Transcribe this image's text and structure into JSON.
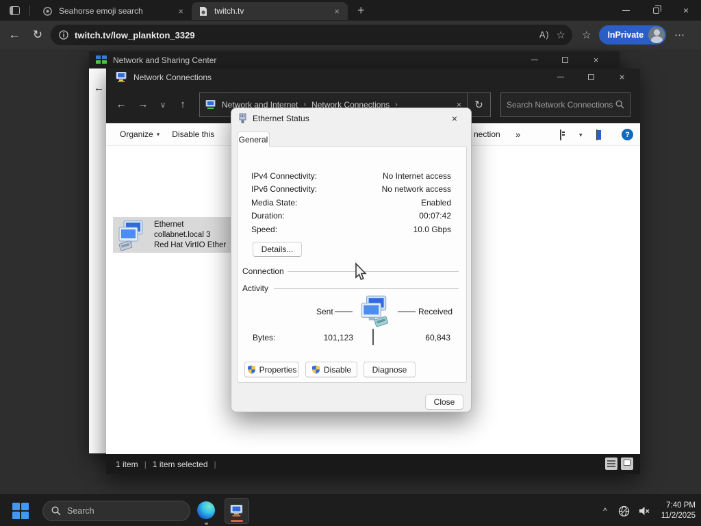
{
  "glyphs": {
    "close": "×",
    "back": "←",
    "forward": "→",
    "up": "↑",
    "down": "∨",
    "refresh": "↻",
    "plus": "+",
    "dots": "⋯",
    "star": "☆",
    "hub_star": "☆",
    "caret": "▾",
    "chevrons": "»",
    "crumb_sep": "›",
    "pipe": "|",
    "readaloud": "A)",
    "tray_chevron": "^",
    "help": "?"
  },
  "browser": {
    "tabs": [
      {
        "label": "Seahorse emoji search"
      },
      {
        "label": "twitch.tv"
      }
    ],
    "url": "twitch.tv/low_plankton_3329",
    "inprivate_label": "InPrivate"
  },
  "nsc_window": {
    "title": "Network and Sharing Center"
  },
  "nc_window": {
    "title": "Network Connections",
    "crumbs": [
      "Network and Internet",
      "Network Connections"
    ],
    "search_placeholder": "Search Network Connections",
    "toolbar": {
      "organize": "Organize",
      "disable_fragment": "Disable this",
      "connection_fragment": "nection"
    },
    "item": {
      "name": "Ethernet",
      "line2": "collabnet.local 3",
      "line3": "Red Hat VirtIO Ether"
    },
    "status": {
      "count": "1 item",
      "selected": "1 item selected"
    }
  },
  "dialog": {
    "title": "Ethernet Status",
    "tab_general": "General",
    "connection_label": "Connection",
    "rows": [
      {
        "label": "IPv4 Connectivity:",
        "value": "No Internet access"
      },
      {
        "label": "IPv6 Connectivity:",
        "value": "No network access"
      },
      {
        "label": "Media State:",
        "value": "Enabled"
      },
      {
        "label": "Duration:",
        "value": "00:07:42"
      },
      {
        "label": "Speed:",
        "value": "10.0 Gbps"
      }
    ],
    "details_button": "Details...",
    "activity_label": "Activity",
    "sent_label": "Sent",
    "received_label": "Received",
    "bytes_label": "Bytes:",
    "sent_value": "101,123",
    "received_value": "60,843",
    "properties_button": "Properties",
    "disable_button": "Disable",
    "diagnose_button": "Diagnose",
    "close_button": "Close"
  },
  "taskbar": {
    "search_placeholder": "Search",
    "time": "7:40 PM",
    "date": "11/2/2025"
  },
  "colors": {
    "inprivate_blue": "#2b5fc7",
    "help_blue": "#0f6cbd",
    "selection_gray": "#d9d9d9",
    "active_app_underline": "#d86344"
  }
}
